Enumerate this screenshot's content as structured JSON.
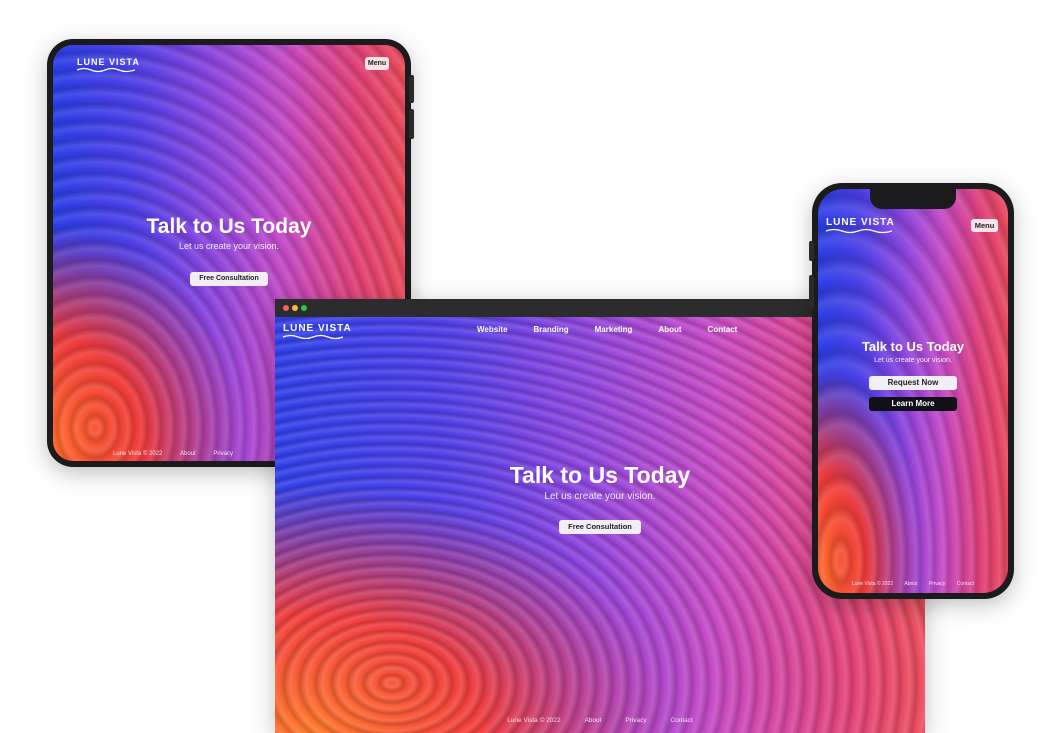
{
  "brand": {
    "name": "Lune Vista"
  },
  "nav": {
    "items": [
      "Website",
      "Branding",
      "Marketing",
      "About",
      "Contact"
    ]
  },
  "menu_label": "Menu",
  "hero": {
    "title": "Talk to Us Today",
    "subtitle": "Let us create your vision.",
    "cta_primary": "Free Consultation",
    "cta_request": "Request Now",
    "cta_learn": "Learn More"
  },
  "footer": {
    "copyright": "Lune Vista © 2022",
    "links": [
      "About",
      "Privacy",
      "Contact"
    ]
  },
  "colors": {
    "close_dot": "#ff5f57",
    "minimize_dot": "#febc2e",
    "zoom_dot": "#28c840"
  }
}
